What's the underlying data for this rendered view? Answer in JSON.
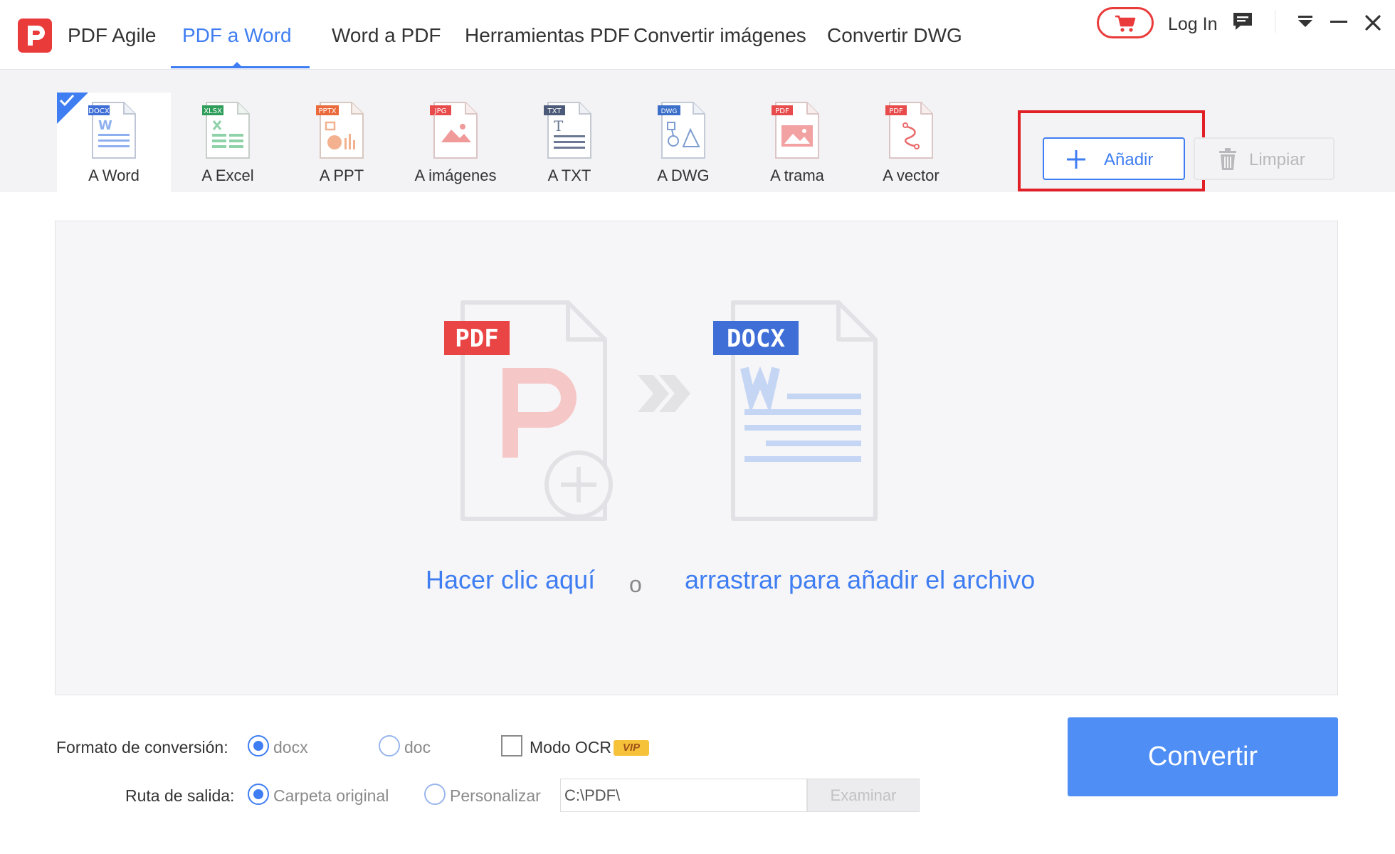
{
  "app": {
    "name": "PDF Agile"
  },
  "nav": {
    "items": [
      {
        "label": "PDF a Word",
        "active": true
      },
      {
        "label": "Word a PDF"
      },
      {
        "label": "Herramientas PDF"
      },
      {
        "label": "Convertir imágenes"
      },
      {
        "label": "Convertir DWG"
      }
    ],
    "login": "Log In"
  },
  "tools": [
    {
      "label": "A Word",
      "badge": "DOCX",
      "badge_color": "#3f6fd6",
      "active": true
    },
    {
      "label": "A Excel",
      "badge": "XLSX",
      "badge_color": "#2f9e5b"
    },
    {
      "label": "A PPT",
      "badge": "PPTX",
      "badge_color": "#ea6a3b"
    },
    {
      "label": "A imágenes",
      "badge": "JPG",
      "badge_color": "#e84b4b"
    },
    {
      "label": "A TXT",
      "badge": "TXT",
      "badge_color": "#4a5a78"
    },
    {
      "label": "A DWG",
      "badge": "DWG",
      "badge_color": "#3b6fc9"
    },
    {
      "label": "A trama",
      "badge": "PDF",
      "badge_color": "#e84b4b"
    },
    {
      "label": "A vector",
      "badge": "PDF",
      "badge_color": "#e84b4b"
    }
  ],
  "actions": {
    "add": "Añadir",
    "clear": "Limpiar"
  },
  "dropzone": {
    "pdf_badge": "PDF",
    "docx_badge": "DOCX",
    "click_text": "Hacer clic aquí",
    "or_text": "o",
    "drag_text": "arrastrar para añadir el archivo"
  },
  "options": {
    "format_label": "Formato de conversión:",
    "format_options": [
      "docx",
      "doc"
    ],
    "format_selected": "docx",
    "ocr_label": "Modo OCR",
    "ocr_badge": "VIP",
    "output_label": "Ruta de salida:",
    "output_options": [
      "Carpeta original",
      "Personalizar"
    ],
    "output_selected": "Carpeta original",
    "path_value": "C:\\PDF\\",
    "browse": "Examinar",
    "convert": "Convertir"
  },
  "colors": {
    "accent": "#3f7ef2",
    "brand": "#ea3b3b",
    "highlight": "#e01f26",
    "convert": "#4f8ef5"
  }
}
